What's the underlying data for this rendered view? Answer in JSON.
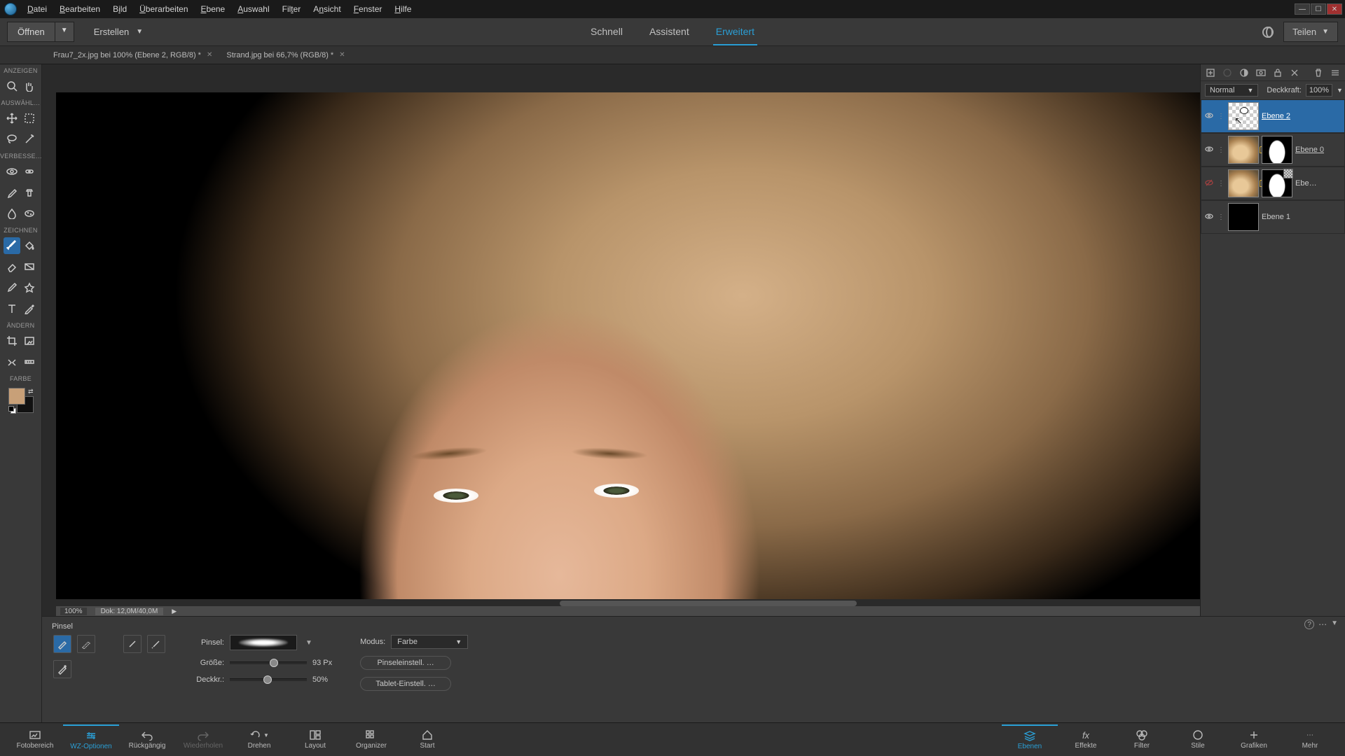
{
  "menu": {
    "datei": "Datei",
    "bearbeiten": "Bearbeiten",
    "bild": "Bild",
    "ueberarbeiten": "Überarbeiten",
    "ebene": "Ebene",
    "auswahl": "Auswahl",
    "filter": "Filter",
    "ansicht": "Ansicht",
    "fenster": "Fenster",
    "hilfe": "Hilfe"
  },
  "topbar": {
    "open": "Öffnen",
    "create": "Erstellen",
    "share": "Teilen"
  },
  "modeTabs": {
    "schnell": "Schnell",
    "assistent": "Assistent",
    "erweitert": "Erweitert",
    "active": "erweitert"
  },
  "docTabs": [
    {
      "label": "Frau7_2x.jpg bei 100% (Ebene 2, RGB/8) *"
    },
    {
      "label": "Strand.jpg bei 66,7% (RGB/8) *"
    }
  ],
  "toolbox": {
    "anzeigen": "ANZEIGEN",
    "auswaehl": "AUSWÄHL…",
    "verbesse": "VERBESSE…",
    "zeichnen": "ZEICHNEN",
    "aendern": "ÄNDERN",
    "farbe": "FARBE",
    "fg": "#c8a078",
    "bg": "#111111"
  },
  "status": {
    "zoom": "100%",
    "docinfo": "Dok: 12,0M/40,0M"
  },
  "layers": {
    "blendMode": "Normal",
    "opacityLabel": "Deckkraft:",
    "opacityValue": "100%",
    "items": [
      {
        "name": "Ebene 2",
        "visible": true,
        "selected": true,
        "thumb": "transparent",
        "cursor": true
      },
      {
        "name": "Ebene 0",
        "visible": true,
        "thumb": "img-mask",
        "locked": true
      },
      {
        "name": "Ebe…",
        "visible": false,
        "thumb": "img-mask",
        "maskBadge": true,
        "locked": true
      },
      {
        "name": "Ebene 1",
        "visible": true,
        "thumb": "black"
      }
    ]
  },
  "options": {
    "title": "Pinsel",
    "brushLabel": "Pinsel:",
    "sizeLabel": "Größe:",
    "sizeValue": "93 Px",
    "sizeKnob": 52,
    "opacityLabel": "Deckkr.:",
    "opacityValue": "50%",
    "opacityKnob": 44,
    "modeLabel": "Modus:",
    "modeValue": "Farbe",
    "btn1": "Pinseleinstell. …",
    "btn2": "Tablet-Einstell. …"
  },
  "tasks": {
    "fotobereich": "Fotobereich",
    "wzoptionen": "WZ-Optionen",
    "rueckgaengig": "Rückgängig",
    "wiederholen": "Wiederholen",
    "drehen": "Drehen",
    "layout": "Layout",
    "organizer": "Organizer",
    "start": "Start",
    "ebenen": "Ebenen",
    "effekte": "Effekte",
    "filter": "Filter",
    "stile": "Stile",
    "grafiken": "Grafiken",
    "mehr": "Mehr"
  }
}
